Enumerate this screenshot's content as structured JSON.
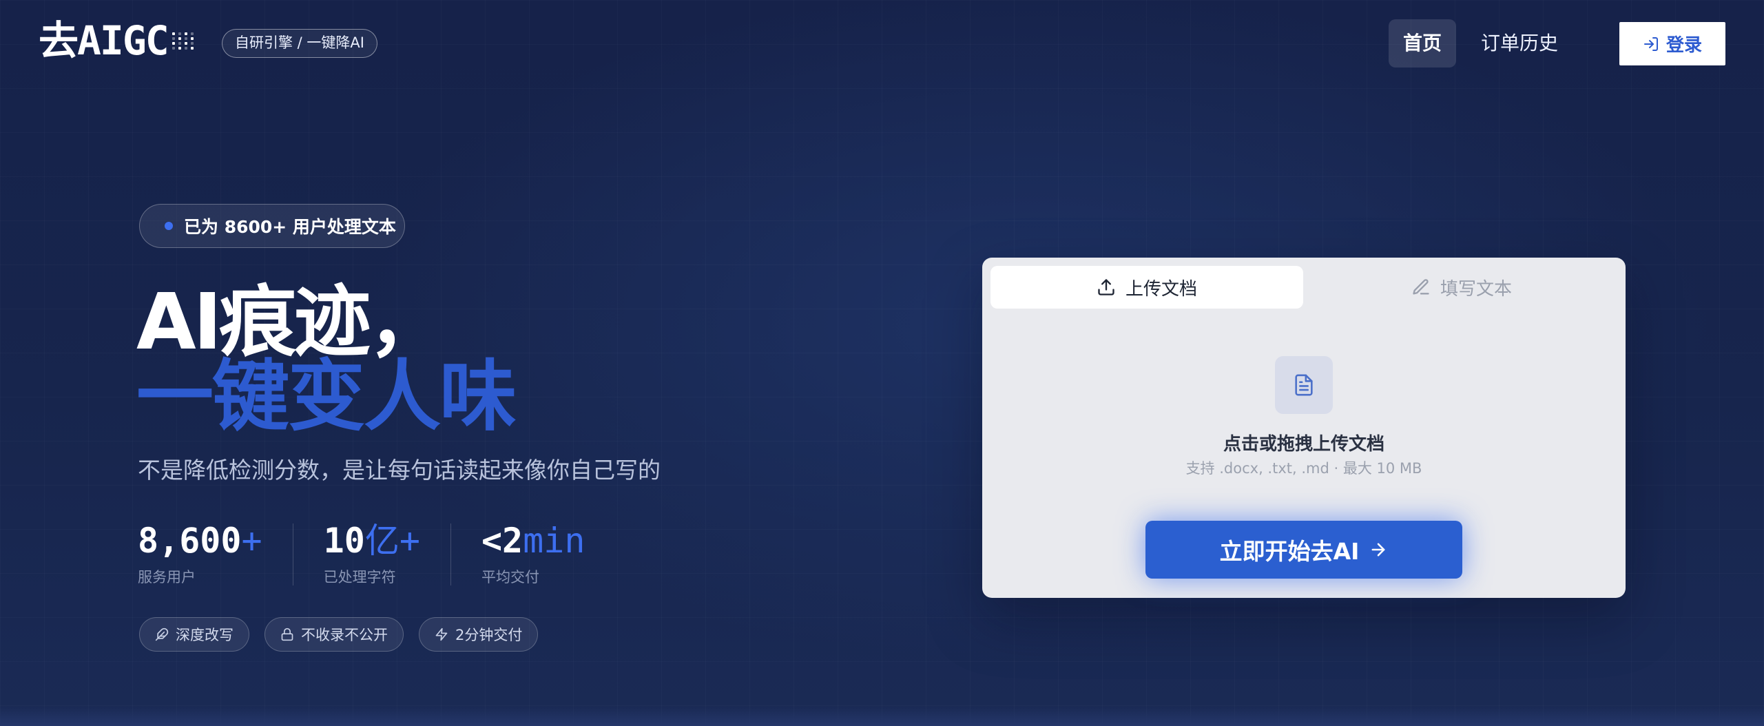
{
  "header": {
    "logo_text": "去AIGC",
    "logo_badge": "自研引擎 / 一键降AI",
    "nav": {
      "home": "首页",
      "orders": "订单历史",
      "login": "登录"
    }
  },
  "hero": {
    "user_pill": "已为 8600+ 用户处理文本",
    "headline_line1": "AI痕迹，",
    "headline_line2": "一键变人味",
    "subtitle": "不是降低检测分数，是让每句话读起来像你自己写的",
    "stats": [
      {
        "value": "8,600",
        "suffix": "+",
        "label": "服务用户"
      },
      {
        "value": "10",
        "suffix": "亿+",
        "label": "已处理字符"
      },
      {
        "value": "<2",
        "suffix": "min",
        "label": "平均交付"
      }
    ],
    "tags": [
      {
        "label": "深度改写",
        "icon": "feather-icon"
      },
      {
        "label": "不收录不公开",
        "icon": "lock-icon"
      },
      {
        "label": "2分钟交付",
        "icon": "lightning-icon"
      }
    ]
  },
  "upload_card": {
    "tab_upload": "上传文档",
    "tab_write": "填写文本",
    "drop_title": "点击或拖拽上传文档",
    "drop_hint": "支持 .docx, .txt, .md · 最大 10 MB",
    "start_button": "立即开始去AI"
  },
  "colors": {
    "background": "#17254d",
    "accent": "#2d5bd0",
    "card": "#e9eaee"
  }
}
